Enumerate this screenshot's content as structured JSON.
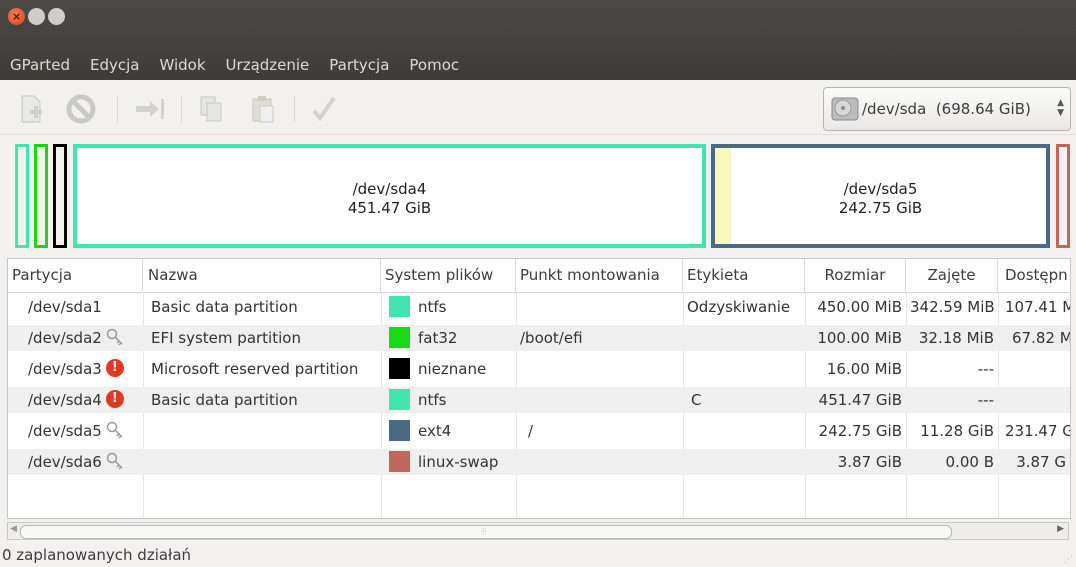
{
  "menubar": [
    "GParted",
    "Edycja",
    "Widok",
    "Urządzenie",
    "Partycja",
    "Pomoc"
  ],
  "toolbar": {
    "icons": [
      "new-partition-icon",
      "delete-icon",
      "resize-move-icon",
      "copy-icon",
      "paste-icon",
      "apply-icon"
    ]
  },
  "device": {
    "name": "/dev/sda",
    "size": "(698.64 GiB)"
  },
  "graph": {
    "sda4": {
      "name": "/dev/sda4",
      "size": "451.47 GiB"
    },
    "sda5": {
      "name": "/dev/sda5",
      "size": "242.75 GiB"
    }
  },
  "colors": {
    "ntfs": "#42e5ac",
    "fat32": "#18d918",
    "unknown": "#000000",
    "ext4": "#4b6983",
    "linux-swap": "#c1665a",
    "used": "#f8f8ba",
    "warning": "#df3a1d"
  },
  "table": {
    "headers": [
      "Partycja",
      "Nazwa",
      "System plików",
      "Punkt montowania",
      "Etykieta",
      "Rozmiar",
      "Zajęte",
      "Dostępn"
    ],
    "rows": [
      {
        "partition": "/dev/sda1",
        "flag": "",
        "name": "Basic data partition",
        "fs": "ntfs",
        "mount": "",
        "label": "Odzyskiwanie",
        "size": "450.00 MiB",
        "used": "342.59 MiB",
        "free": "107.41 M"
      },
      {
        "partition": "/dev/sda2",
        "flag": "key",
        "name": "EFI system partition",
        "fs": "fat32",
        "mount": "/boot/efi",
        "label": "",
        "size": "100.00 MiB",
        "used": "32.18 MiB",
        "free": "67.82 M"
      },
      {
        "partition": "/dev/sda3",
        "flag": "warning",
        "name": "Microsoft reserved partition",
        "fs": "nieznane",
        "mount": "",
        "label": "",
        "size": "16.00 MiB",
        "used": "---",
        "free": ""
      },
      {
        "partition": "/dev/sda4",
        "flag": "warning",
        "name": "Basic data partition",
        "fs": "ntfs",
        "mount": "",
        "label": "C",
        "size": "451.47 GiB",
        "used": "---",
        "free": ""
      },
      {
        "partition": "/dev/sda5",
        "flag": "key",
        "name": "",
        "fs": "ext4",
        "mount": "/",
        "label": "",
        "size": "242.75 GiB",
        "used": "11.28 GiB",
        "free": "231.47 G"
      },
      {
        "partition": "/dev/sda6",
        "flag": "key",
        "name": "",
        "fs": "linux-swap",
        "mount": "",
        "label": "",
        "size": "3.87 GiB",
        "used": "0.00 B",
        "free": "3.87 G"
      }
    ]
  },
  "statusbar": {
    "text": "0 zaplanowanych działań"
  }
}
